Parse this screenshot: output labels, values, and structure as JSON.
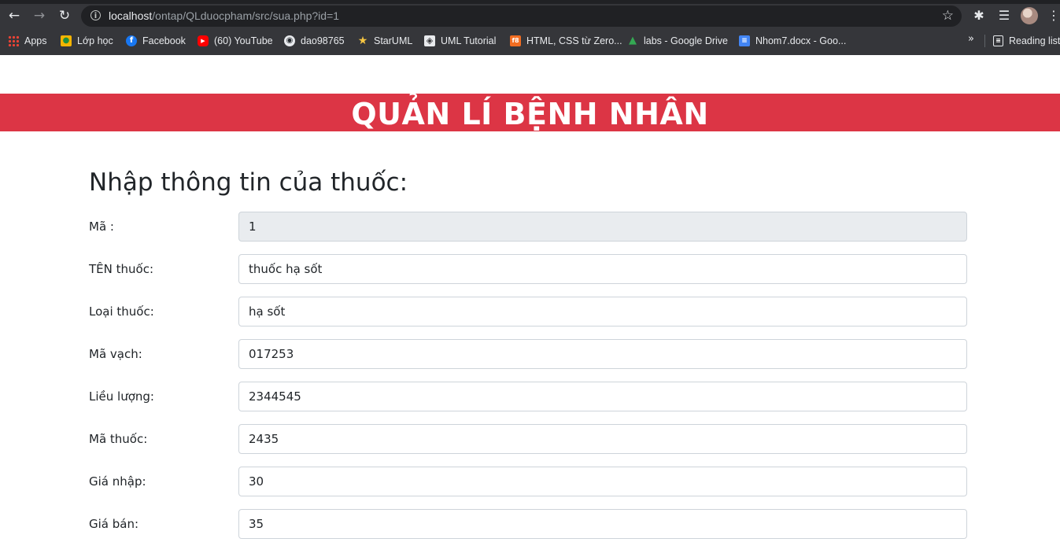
{
  "browser": {
    "url_host": "localhost",
    "url_path": "/ontap/QLduocpham/src/sua.php?id=1",
    "bookmarks": [
      {
        "label": "Apps",
        "icon": "apps-grid-icon"
      },
      {
        "label": "Lớp học",
        "icon": "classroom-icon"
      },
      {
        "label": "Facebook",
        "icon": "facebook-icon"
      },
      {
        "label": "(60) YouTube",
        "icon": "youtube-icon"
      },
      {
        "label": "dao98765",
        "icon": "github-icon"
      },
      {
        "label": "StarUML",
        "icon": "staruml-icon"
      },
      {
        "label": "UML Tutorial",
        "icon": "uml-icon"
      },
      {
        "label": "HTML, CSS từ Zero...",
        "icon": "f8-icon"
      },
      {
        "label": "labs - Google Drive",
        "icon": "google-drive-icon"
      },
      {
        "label": "Nhom7.docx - Goo...",
        "icon": "google-docs-icon"
      }
    ],
    "reading_list": "Reading list",
    "colors": {
      "chrome": "#35363a",
      "omnibox": "#202124"
    }
  },
  "page": {
    "banner_title": "QUẢN LÍ BỆNH NHÂN",
    "form_title": "Nhập thông tin của thuốc:",
    "fields": [
      {
        "label": "Mã :",
        "value": "1",
        "readonly": true
      },
      {
        "label": "TÊN thuốc:",
        "value": "thuốc hạ sốt"
      },
      {
        "label": "Loại thuốc:",
        "value": "hạ sốt"
      },
      {
        "label": "Mã vạch:",
        "value": "017253"
      },
      {
        "label": "Liều lượng:",
        "value": "2344545"
      },
      {
        "label": "Mã thuốc:",
        "value": "2435"
      },
      {
        "label": "Giá nhập:",
        "value": "30"
      },
      {
        "label": "Giá bán:",
        "value": "35"
      }
    ],
    "colors": {
      "banner": "#dc3545",
      "readonly_bg": "#e9ecef"
    }
  }
}
